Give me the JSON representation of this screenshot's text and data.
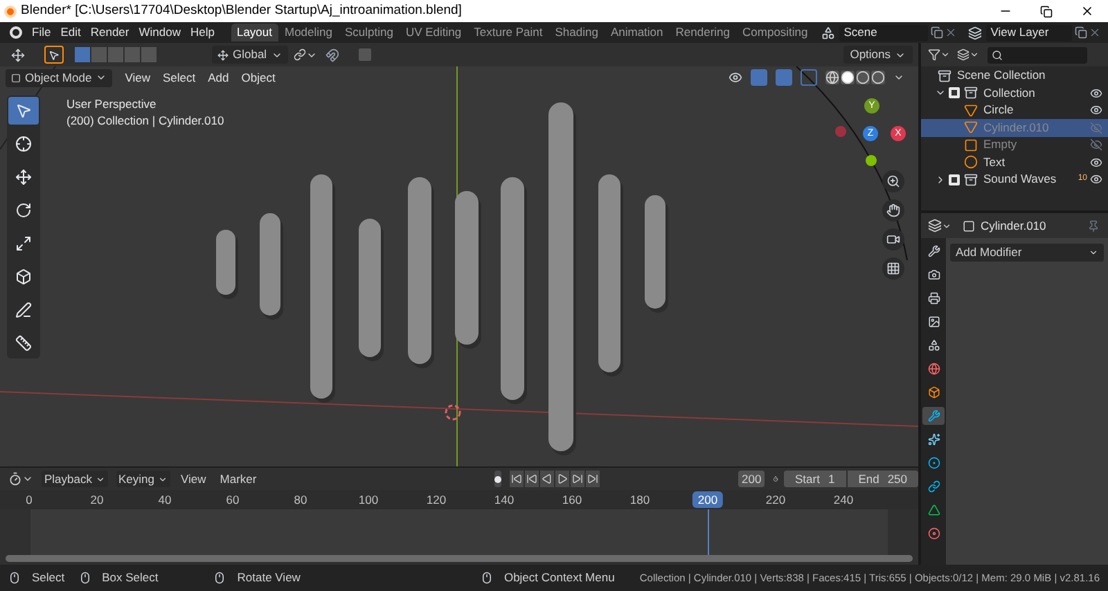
{
  "window": {
    "title": "Blender* [C:\\Users\\17704\\Desktop\\Blender Startup\\Aj_introanimation.blend]"
  },
  "menu": [
    "File",
    "Edit",
    "Render",
    "Window",
    "Help"
  ],
  "workspaces": [
    {
      "label": "Layout",
      "selected": true
    },
    {
      "label": "Modeling",
      "selected": false
    },
    {
      "label": "Sculpting",
      "selected": false
    },
    {
      "label": "UV Editing",
      "selected": false
    },
    {
      "label": "Texture Paint",
      "selected": false
    },
    {
      "label": "Shading",
      "selected": false
    },
    {
      "label": "Animation",
      "selected": false
    },
    {
      "label": "Rendering",
      "selected": false
    },
    {
      "label": "Compositing",
      "selected": false
    }
  ],
  "scene": {
    "name": "Scene"
  },
  "view_layer": {
    "name": "View Layer"
  },
  "tool_header": {
    "orientation": "Global",
    "options": "Options"
  },
  "viewport_header": {
    "mode": "Object Mode",
    "menus": [
      "View",
      "Select",
      "Add",
      "Object"
    ]
  },
  "toolbar": [
    {
      "kind": "select",
      "selected": true
    },
    {
      "kind": "cursor",
      "selected": false
    },
    {
      "kind": "move",
      "selected": false
    },
    {
      "kind": "rotate",
      "selected": false
    },
    {
      "kind": "scale",
      "selected": false
    },
    {
      "kind": "transform",
      "selected": false
    },
    {
      "kind": "annotate",
      "selected": false
    },
    {
      "kind": "measure",
      "selected": false
    }
  ],
  "viewport": {
    "perspective": "User Perspective",
    "info": "(200) Collection | Cylinder.010",
    "axes": [
      "Y",
      "Z",
      "X"
    ]
  },
  "outliner": {
    "root": "Scene Collection",
    "items": [
      {
        "name": "Collection",
        "kind": "collection",
        "checked": true,
        "expanded": true,
        "selected": false,
        "visible": true,
        "children": [
          {
            "name": "Circle",
            "kind": "mesh",
            "selected": false,
            "visible": true
          },
          {
            "name": "Cylinder.010",
            "kind": "mesh",
            "selected": true,
            "visible": false
          },
          {
            "name": "Empty",
            "kind": "empty",
            "selected": false,
            "visible": false
          },
          {
            "name": "Text",
            "kind": "text",
            "selected": false,
            "visible": true
          }
        ]
      },
      {
        "name": "Sound Waves",
        "kind": "collection",
        "checked": true,
        "expanded": false,
        "selected": false,
        "visible": true,
        "count": "10"
      }
    ]
  },
  "properties": {
    "object": "Cylinder.010",
    "add_modifier": "Add Modifier",
    "tabs": [
      {
        "kind": "tool",
        "selected": false
      },
      {
        "kind": "render",
        "selected": false
      },
      {
        "kind": "output",
        "selected": false
      },
      {
        "kind": "view_layer",
        "selected": false
      },
      {
        "kind": "scene",
        "selected": false
      },
      {
        "kind": "world",
        "selected": false
      },
      {
        "kind": "object",
        "selected": false
      },
      {
        "kind": "modifier",
        "selected": true
      },
      {
        "kind": "particles",
        "selected": false
      },
      {
        "kind": "physics",
        "selected": false
      },
      {
        "kind": "constraints",
        "selected": false
      },
      {
        "kind": "data",
        "selected": false
      },
      {
        "kind": "material",
        "selected": false
      }
    ]
  },
  "timeline": {
    "menus": [
      "Playback",
      "Keying",
      "View",
      "Marker"
    ],
    "current_frame": "200",
    "start_label": "Start",
    "start": "1",
    "end_label": "End",
    "end": "250",
    "ticks": [
      {
        "label": "0",
        "selected": false
      },
      {
        "label": "20",
        "selected": false
      },
      {
        "label": "40",
        "selected": false
      },
      {
        "label": "60",
        "selected": false
      },
      {
        "label": "80",
        "selected": false
      },
      {
        "label": "100",
        "selected": false
      },
      {
        "label": "120",
        "selected": false
      },
      {
        "label": "140",
        "selected": false
      },
      {
        "label": "160",
        "selected": false
      },
      {
        "label": "180",
        "selected": false
      },
      {
        "label": "200",
        "selected": true
      },
      {
        "label": "220",
        "selected": false
      },
      {
        "label": "240",
        "selected": false
      }
    ]
  },
  "status_bar": {
    "hints": [
      "Select",
      "Box Select",
      "Rotate View",
      "Object Context Menu"
    ],
    "stats": "Collection | Cylinder.010 | Verts:838 | Faces:415 | Tris:655 | Objects:0/12 | Mem: 29.0 MiB | v2.81.16"
  }
}
